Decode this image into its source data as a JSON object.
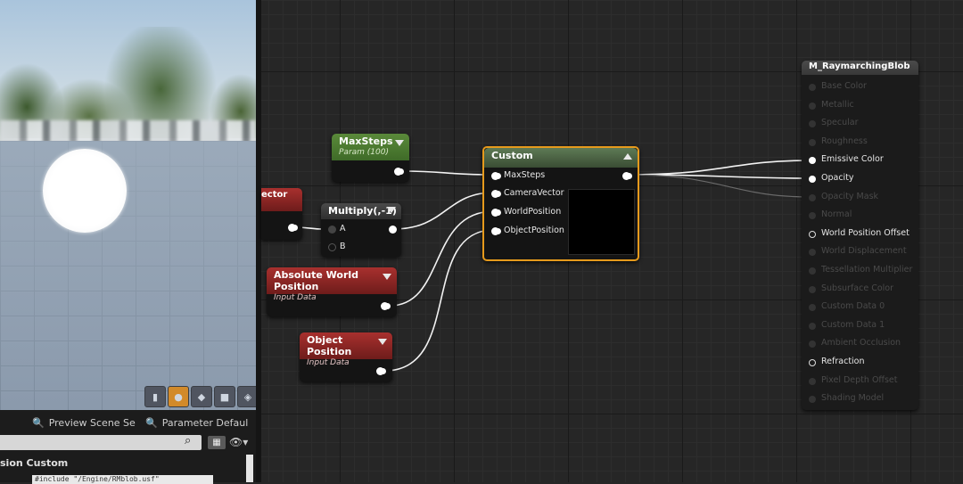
{
  "viewport": {
    "toolbar_icons": [
      "cylinder-icon",
      "sphere-icon",
      "plane-icon",
      "cube-icon",
      "custom-mesh-icon"
    ]
  },
  "bottom_panel": {
    "tab1_label": "Preview Scene Se",
    "tab2_label": "Parameter Defaul",
    "detail_title": "sion Custom",
    "code_line": "#include \"/Engine/RMblob.usf\""
  },
  "nodes": {
    "maxsteps": {
      "title": "MaxSteps",
      "subtitle": "Param (100)"
    },
    "vector_clip": {
      "title": "ector"
    },
    "multiply": {
      "title": "Multiply(,-1)",
      "in_a": "A",
      "in_b": "B"
    },
    "absolute_world_position": {
      "title": "Absolute World Position",
      "subtitle": "Input Data"
    },
    "object_position": {
      "title": "Object Position",
      "subtitle": "Input Data"
    },
    "custom": {
      "title": "Custom",
      "inputs": [
        "MaxSteps",
        "CameraVector",
        "WorldPosition",
        "ObjectPosition"
      ]
    },
    "result": {
      "title": "M_RaymarchingBlob",
      "inputs": [
        {
          "label": "Base Color",
          "state": "dim"
        },
        {
          "label": "Metallic",
          "state": "dim"
        },
        {
          "label": "Specular",
          "state": "dim"
        },
        {
          "label": "Roughness",
          "state": "dim"
        },
        {
          "label": "Emissive Color",
          "state": "on"
        },
        {
          "label": "Opacity",
          "state": "on"
        },
        {
          "label": "Opacity Mask",
          "state": "dim"
        },
        {
          "label": "Normal",
          "state": "dim"
        },
        {
          "label": "World Position Offset",
          "state": "ring"
        },
        {
          "label": "World Displacement",
          "state": "dim"
        },
        {
          "label": "Tessellation Multiplier",
          "state": "dim"
        },
        {
          "label": "Subsurface Color",
          "state": "dim"
        },
        {
          "label": "Custom Data 0",
          "state": "dim"
        },
        {
          "label": "Custom Data 1",
          "state": "dim"
        },
        {
          "label": "Ambient Occlusion",
          "state": "dim"
        },
        {
          "label": "Refraction",
          "state": "ring"
        },
        {
          "label": "Pixel Depth Offset",
          "state": "dim"
        },
        {
          "label": "Shading Model",
          "state": "dim"
        }
      ]
    }
  }
}
